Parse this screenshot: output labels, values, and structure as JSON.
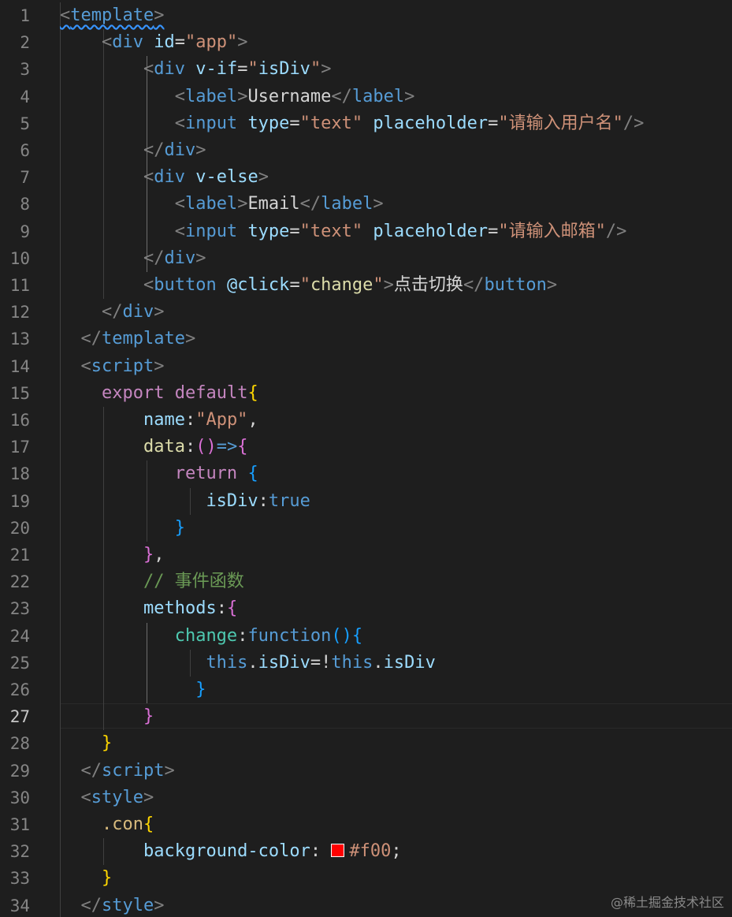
{
  "editor": {
    "theme_background": "#1e1e1e",
    "current_line": 27,
    "watermark": "@稀土掘金技术社区",
    "lines": [
      {
        "n": "1",
        "tokens": [
          [
            "t-punc squiggle",
            "<"
          ],
          [
            "t-tag squiggle",
            "template"
          ],
          [
            "t-punc squiggle",
            ">"
          ]
        ]
      },
      {
        "n": "2",
        "tokens": [
          [
            "t-text",
            "    "
          ],
          [
            "t-punc",
            "<"
          ],
          [
            "t-tag",
            "div"
          ],
          [
            "t-text",
            " "
          ],
          [
            "t-attr",
            "id"
          ],
          [
            "t-text",
            "="
          ],
          [
            "t-str",
            "\"app\""
          ],
          [
            "t-punc",
            ">"
          ]
        ]
      },
      {
        "n": "3",
        "tokens": [
          [
            "t-text",
            "        "
          ],
          [
            "t-punc",
            "<"
          ],
          [
            "t-tag",
            "div"
          ],
          [
            "t-text",
            " "
          ],
          [
            "t-attr",
            "v-if"
          ],
          [
            "t-text",
            "="
          ],
          [
            "t-str",
            "\""
          ],
          [
            "t-attr",
            "isDiv"
          ],
          [
            "t-str",
            "\""
          ],
          [
            "t-punc",
            ">"
          ]
        ]
      },
      {
        "n": "4",
        "tokens": [
          [
            "t-text",
            "           "
          ],
          [
            "t-punc",
            "<"
          ],
          [
            "t-tag",
            "label"
          ],
          [
            "t-punc",
            ">"
          ],
          [
            "t-text",
            "Username"
          ],
          [
            "t-punc",
            "</"
          ],
          [
            "t-tag",
            "label"
          ],
          [
            "t-punc",
            ">"
          ]
        ]
      },
      {
        "n": "5",
        "tokens": [
          [
            "t-text",
            "           "
          ],
          [
            "t-punc",
            "<"
          ],
          [
            "t-tag",
            "input"
          ],
          [
            "t-text",
            " "
          ],
          [
            "t-attr",
            "type"
          ],
          [
            "t-text",
            "="
          ],
          [
            "t-str",
            "\"text\""
          ],
          [
            "t-text",
            " "
          ],
          [
            "t-attr",
            "placeholder"
          ],
          [
            "t-text",
            "="
          ],
          [
            "t-str",
            "\"请输入用户名\""
          ],
          [
            "t-punc",
            "/>"
          ]
        ]
      },
      {
        "n": "6",
        "tokens": [
          [
            "t-text",
            "        "
          ],
          [
            "t-punc",
            "</"
          ],
          [
            "t-tag",
            "div"
          ],
          [
            "t-punc",
            ">"
          ]
        ]
      },
      {
        "n": "7",
        "tokens": [
          [
            "t-text",
            "        "
          ],
          [
            "t-punc",
            "<"
          ],
          [
            "t-tag",
            "div"
          ],
          [
            "t-text",
            " "
          ],
          [
            "t-attr",
            "v-else"
          ],
          [
            "t-punc",
            ">"
          ]
        ]
      },
      {
        "n": "8",
        "tokens": [
          [
            "t-text",
            "           "
          ],
          [
            "t-punc",
            "<"
          ],
          [
            "t-tag",
            "label"
          ],
          [
            "t-punc",
            ">"
          ],
          [
            "t-text",
            "Email"
          ],
          [
            "t-punc",
            "</"
          ],
          [
            "t-tag",
            "label"
          ],
          [
            "t-punc",
            ">"
          ]
        ]
      },
      {
        "n": "9",
        "tokens": [
          [
            "t-text",
            "           "
          ],
          [
            "t-punc",
            "<"
          ],
          [
            "t-tag",
            "input"
          ],
          [
            "t-text",
            " "
          ],
          [
            "t-attr",
            "type"
          ],
          [
            "t-text",
            "="
          ],
          [
            "t-str",
            "\"text\""
          ],
          [
            "t-text",
            " "
          ],
          [
            "t-attr",
            "placeholder"
          ],
          [
            "t-text",
            "="
          ],
          [
            "t-str",
            "\"请输入邮箱\""
          ],
          [
            "t-punc",
            "/>"
          ]
        ]
      },
      {
        "n": "10",
        "tokens": [
          [
            "t-text",
            "        "
          ],
          [
            "t-punc",
            "</"
          ],
          [
            "t-tag",
            "div"
          ],
          [
            "t-punc",
            ">"
          ]
        ]
      },
      {
        "n": "11",
        "tokens": [
          [
            "t-text",
            "        "
          ],
          [
            "t-punc",
            "<"
          ],
          [
            "t-tag",
            "button"
          ],
          [
            "t-text",
            " "
          ],
          [
            "t-attr",
            "@click"
          ],
          [
            "t-text",
            "="
          ],
          [
            "t-str",
            "\""
          ],
          [
            "t-fn",
            "change"
          ],
          [
            "t-str",
            "\""
          ],
          [
            "t-punc",
            ">"
          ],
          [
            "t-text",
            "点击切换"
          ],
          [
            "t-punc",
            "</"
          ],
          [
            "t-tag",
            "button"
          ],
          [
            "t-punc",
            ">"
          ]
        ]
      },
      {
        "n": "12",
        "tokens": [
          [
            "t-text",
            "    "
          ],
          [
            "t-punc",
            "</"
          ],
          [
            "t-tag",
            "div"
          ],
          [
            "t-punc",
            ">"
          ]
        ]
      },
      {
        "n": "13",
        "tokens": [
          [
            "t-text",
            "  "
          ],
          [
            "t-punc",
            "</"
          ],
          [
            "t-tag",
            "template"
          ],
          [
            "t-punc",
            ">"
          ]
        ]
      },
      {
        "n": "14",
        "tokens": [
          [
            "t-text",
            "  "
          ],
          [
            "t-punc",
            "<"
          ],
          [
            "t-tag",
            "script"
          ],
          [
            "t-punc",
            ">"
          ]
        ]
      },
      {
        "n": "15",
        "tokens": [
          [
            "t-text",
            "    "
          ],
          [
            "t-kw",
            "export"
          ],
          [
            "t-text",
            " "
          ],
          [
            "t-kw",
            "default"
          ],
          [
            "t-b1",
            "{"
          ]
        ]
      },
      {
        "n": "16",
        "tokens": [
          [
            "t-text",
            "        "
          ],
          [
            "t-prop",
            "name"
          ],
          [
            "t-text",
            ":"
          ],
          [
            "t-str",
            "\"App\""
          ],
          [
            "t-text",
            ","
          ]
        ]
      },
      {
        "n": "17",
        "tokens": [
          [
            "t-text",
            "        "
          ],
          [
            "t-fn",
            "data"
          ],
          [
            "t-text",
            ":"
          ],
          [
            "t-b2",
            "()"
          ],
          [
            "t-storage",
            "=>"
          ],
          [
            "t-b2",
            "{"
          ]
        ]
      },
      {
        "n": "18",
        "tokens": [
          [
            "t-text",
            "           "
          ],
          [
            "t-kw",
            "return"
          ],
          [
            "t-text",
            " "
          ],
          [
            "t-b3",
            "{"
          ]
        ]
      },
      {
        "n": "19",
        "tokens": [
          [
            "t-text",
            "              "
          ],
          [
            "t-prop",
            "isDiv"
          ],
          [
            "t-text",
            ":"
          ],
          [
            "t-storage",
            "true"
          ]
        ]
      },
      {
        "n": "20",
        "tokens": [
          [
            "t-text",
            "           "
          ],
          [
            "t-b3",
            "}"
          ]
        ]
      },
      {
        "n": "21",
        "tokens": [
          [
            "t-text",
            "        "
          ],
          [
            "t-b2",
            "}"
          ],
          [
            "t-text",
            ","
          ]
        ]
      },
      {
        "n": "22",
        "tokens": [
          [
            "t-text",
            "        "
          ],
          [
            "t-comment",
            "// 事件函数"
          ]
        ]
      },
      {
        "n": "23",
        "tokens": [
          [
            "t-text",
            "        "
          ],
          [
            "t-prop",
            "methods"
          ],
          [
            "t-text",
            ":"
          ],
          [
            "t-b2",
            "{"
          ]
        ]
      },
      {
        "n": "24",
        "tokens": [
          [
            "t-text",
            "           "
          ],
          [
            "t-method",
            "change"
          ],
          [
            "t-text",
            ":"
          ],
          [
            "t-storage",
            "function"
          ],
          [
            "t-b3",
            "(){"
          ]
        ]
      },
      {
        "n": "25",
        "tokens": [
          [
            "t-text",
            "              "
          ],
          [
            "t-storage",
            "this"
          ],
          [
            "t-text",
            "."
          ],
          [
            "t-prop",
            "isDiv"
          ],
          [
            "t-text",
            "=!"
          ],
          [
            "t-storage",
            "this"
          ],
          [
            "t-text",
            "."
          ],
          [
            "t-prop",
            "isDiv"
          ]
        ]
      },
      {
        "n": "26",
        "tokens": [
          [
            "t-text",
            "             "
          ],
          [
            "t-b3",
            "}"
          ]
        ]
      },
      {
        "n": "27",
        "tokens": [
          [
            "t-text",
            "        "
          ],
          [
            "t-b2",
            "}"
          ]
        ]
      },
      {
        "n": "28",
        "tokens": [
          [
            "t-text",
            "    "
          ],
          [
            "t-b1",
            "}"
          ]
        ]
      },
      {
        "n": "29",
        "tokens": [
          [
            "t-text",
            "  "
          ],
          [
            "t-punc",
            "</"
          ],
          [
            "t-tag",
            "script"
          ],
          [
            "t-punc",
            ">"
          ]
        ]
      },
      {
        "n": "30",
        "tokens": [
          [
            "t-text",
            "  "
          ],
          [
            "t-punc",
            "<"
          ],
          [
            "t-tag",
            "style"
          ],
          [
            "t-punc",
            ">"
          ]
        ]
      },
      {
        "n": "31",
        "tokens": [
          [
            "t-text",
            "    "
          ],
          [
            "t-sel",
            ".con"
          ],
          [
            "t-b1",
            "{"
          ]
        ]
      },
      {
        "n": "32",
        "tokens": [
          [
            "t-text",
            "        "
          ],
          [
            "t-cssprop",
            "background-color"
          ],
          [
            "t-text",
            ": "
          ],
          [
            "swatch",
            "#ff0000"
          ],
          [
            "t-cssval",
            "#f00"
          ],
          [
            "t-text",
            ";"
          ]
        ]
      },
      {
        "n": "33",
        "tokens": [
          [
            "t-text",
            "    "
          ],
          [
            "t-b1",
            "}"
          ]
        ]
      },
      {
        "n": "34",
        "tokens": [
          [
            "t-text",
            "  "
          ],
          [
            "t-punc",
            "</"
          ],
          [
            "t-tag",
            "style"
          ],
          [
            "t-punc",
            ">"
          ]
        ]
      }
    ]
  }
}
